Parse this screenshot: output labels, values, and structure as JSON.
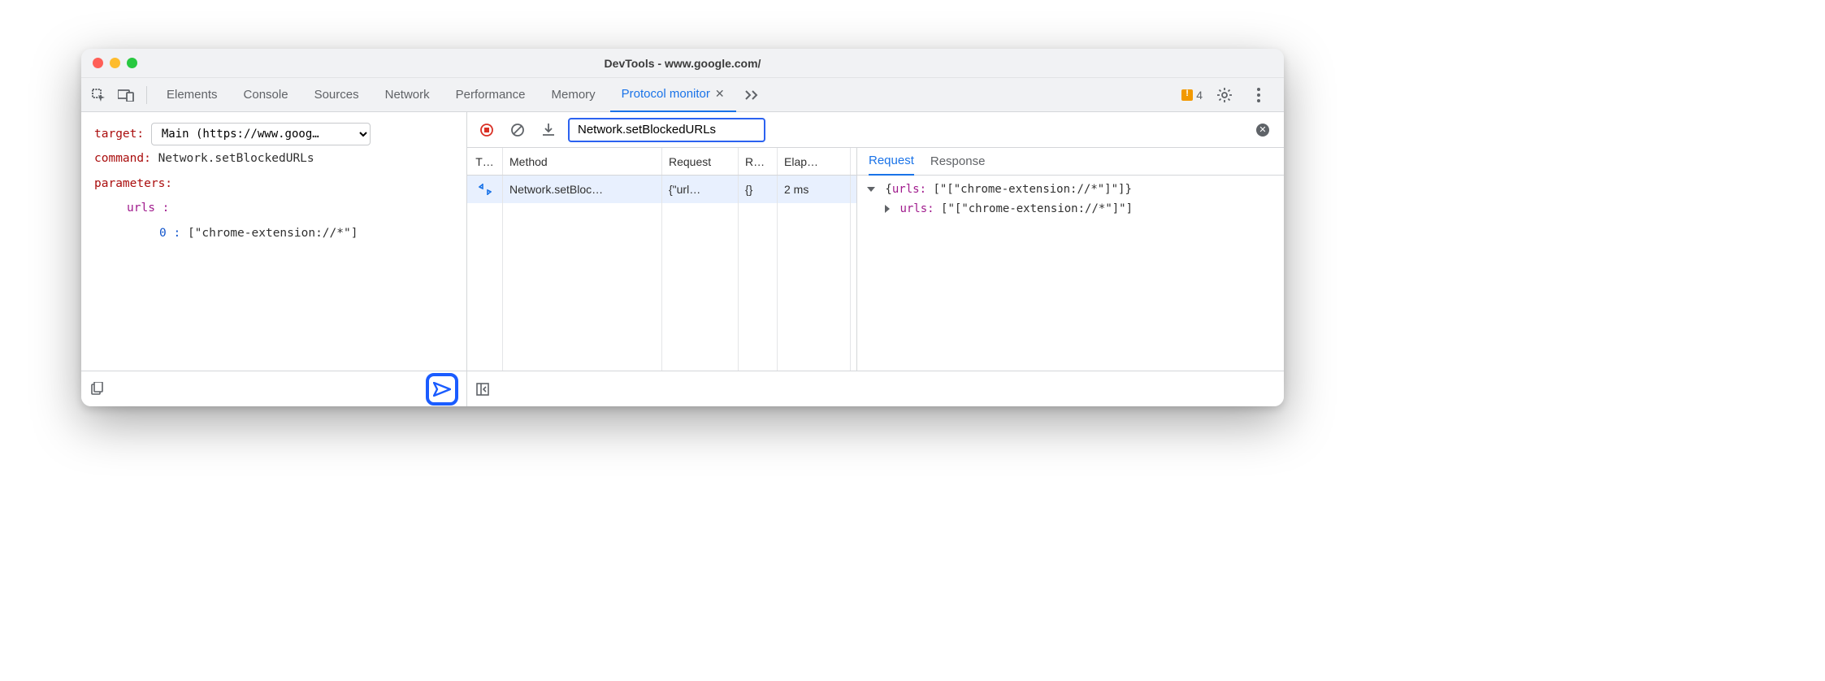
{
  "title": "DevTools - www.google.com/",
  "tabs": {
    "items": [
      "Elements",
      "Console",
      "Sources",
      "Network",
      "Performance",
      "Memory",
      "Protocol monitor"
    ]
  },
  "warning_count": "4",
  "editor": {
    "target_label": "target:",
    "target_value": "Main (https://www.goog…",
    "command_label": "command:",
    "command_value": "Network.setBlockedURLs",
    "parameters_label": "parameters:",
    "param_key": "urls :",
    "param_idx": "0 :",
    "param_val": "[\"chrome-extension://*\"]"
  },
  "filter": {
    "value": "Network.setBlockedURLs"
  },
  "grid": {
    "headers": {
      "c1": "T…",
      "c2": "Method",
      "c3": "Request",
      "c4": "R…",
      "c5": "Elap…"
    },
    "rows": [
      {
        "method": "Network.setBloc…",
        "request": "{\"url…",
        "response": "{}",
        "elapsed": "2 ms"
      }
    ]
  },
  "detail": {
    "tabs": [
      "Request",
      "Response"
    ],
    "line1_key": "urls:",
    "line1_val": "[\"[\"chrome-extension://*\"]\"]",
    "line2_key": "urls:",
    "line2_val": "[\"[\"chrome-extension://*\"]\"]"
  }
}
